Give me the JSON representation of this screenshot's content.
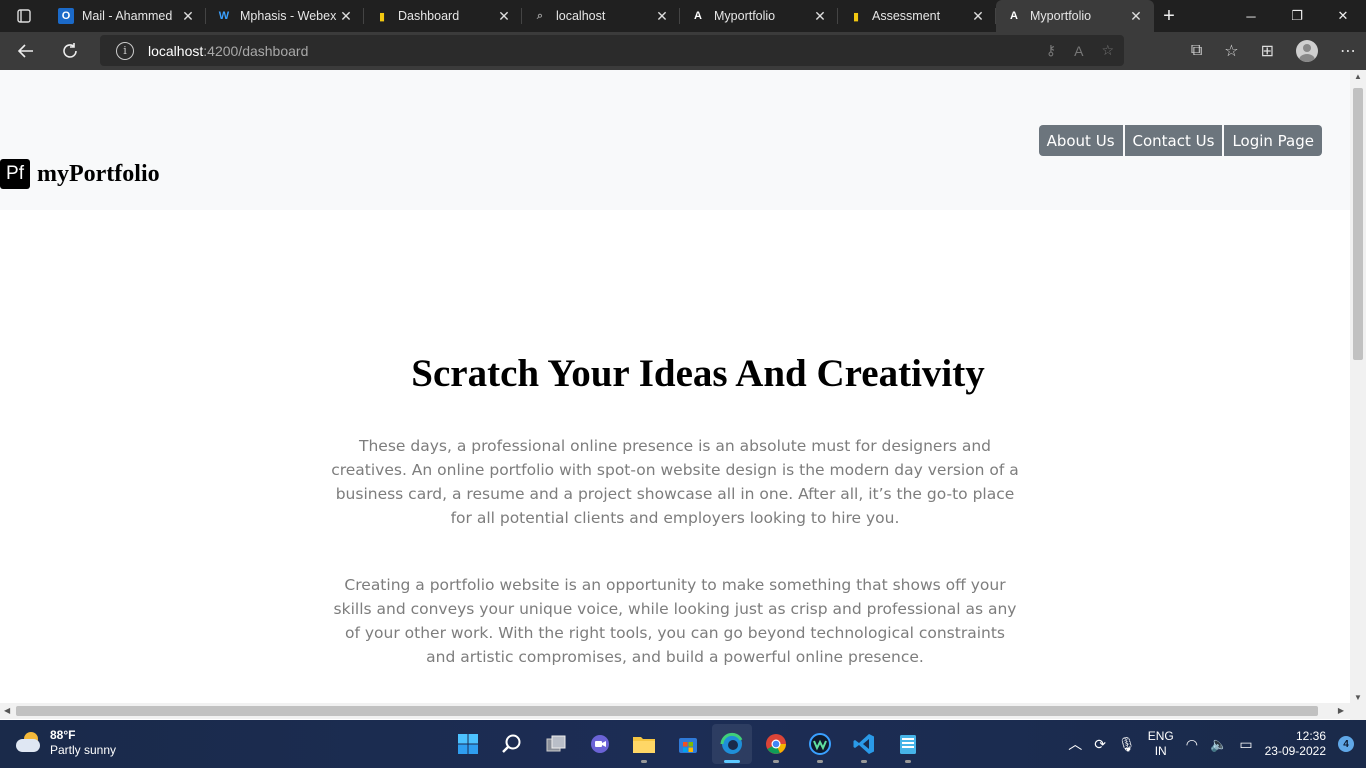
{
  "browser": {
    "tabs": [
      {
        "title": "Mail - Ahammed",
        "icon": "outlook-icon",
        "color": "#1b6ac9"
      },
      {
        "title": "Mphasis - Webex",
        "icon": "webex-icon",
        "color": "#3aa0ff"
      },
      {
        "title": "Dashboard",
        "icon": "powerbi-icon",
        "color": "#f2c811"
      },
      {
        "title": "localhost",
        "icon": "page-icon",
        "color": "#999999"
      },
      {
        "title": "Myportfolio",
        "icon": "angular-icon",
        "color": "#ffffff"
      },
      {
        "title": "Assessment",
        "icon": "powerbi-icon",
        "color": "#f2c811"
      },
      {
        "title": "Myportfolio",
        "icon": "angular-icon",
        "color": "#ffffff",
        "active": true
      }
    ],
    "address": {
      "host": "localhost",
      "path": ":4200/dashboard"
    }
  },
  "site": {
    "logo_text": "Pf",
    "brand": "myPortfolio",
    "nav": [
      "About Us",
      "Contact Us",
      "Login Page"
    ],
    "hero_title": "Scratch Your Ideas And Creativity",
    "paragraph1": "These days, a professional online presence is an absolute must for designers and creatives. An online portfolio with spot-on website design is the modern day version of a business card, a resume and a project showcase all in one. After all, it’s the go-to place for all potential clients and employers looking to hire you.",
    "paragraph2": "Creating a portfolio website is an opportunity to make something that shows off your skills and conveys your unique voice, while looking just as crisp and professional as any of your other work. With the right tools, you can go beyond technological constraints and artistic compromises, and build a powerful online presence."
  },
  "taskbar": {
    "weather_temp": "88°F",
    "weather_desc": "Partly sunny",
    "lang_top": "ENG",
    "lang_bottom": "IN",
    "time": "12:36",
    "date": "23-09-2022",
    "notification_count": "4"
  }
}
